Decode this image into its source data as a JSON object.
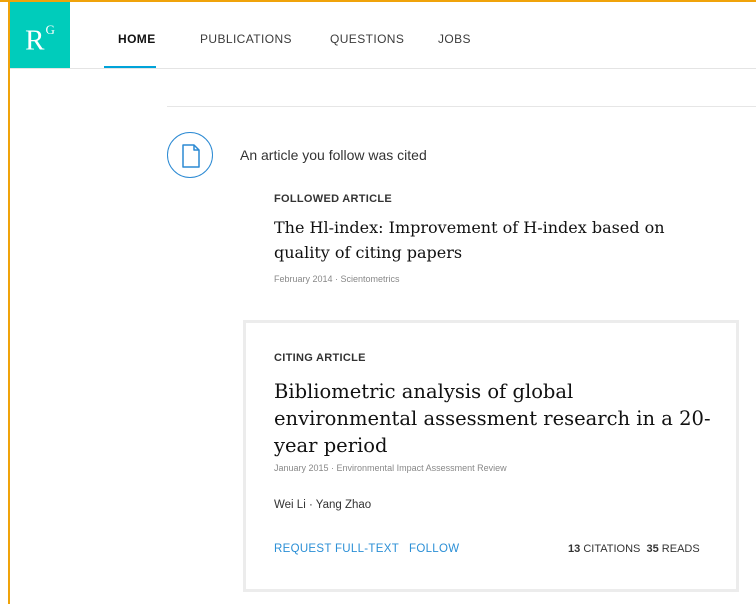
{
  "logo": {
    "main": "R",
    "sup": "G"
  },
  "nav": {
    "home": "HOME",
    "publications": "PUBLICATIONS",
    "questions": "QUESTIONS",
    "jobs": "JOBS"
  },
  "notification": {
    "text": "An article you follow was cited",
    "icon": "document-icon"
  },
  "followed": {
    "label": "FOLLOWED ARTICLE",
    "title": "The Hl-index: Improvement of H-index based on quality of citing papers",
    "meta": "February 2014 · Scientometrics"
  },
  "citing": {
    "label": "CITING ARTICLE",
    "title": "Bibliometric analysis of global environmental assessment research in a 20-year period",
    "meta": "January 2015 · Environmental Impact Assessment Review",
    "authors": "Wei Li · Yang Zhao",
    "request_label": "REQUEST FULL-TEXT",
    "follow_label": "FOLLOW",
    "citations_count": "13",
    "citations_label": "CITATIONS",
    "reads_count": "35",
    "reads_label": "READS"
  },
  "colors": {
    "brand": "#00ccbb",
    "accent": "#2b8fd6",
    "frame": "#f0a30a"
  }
}
